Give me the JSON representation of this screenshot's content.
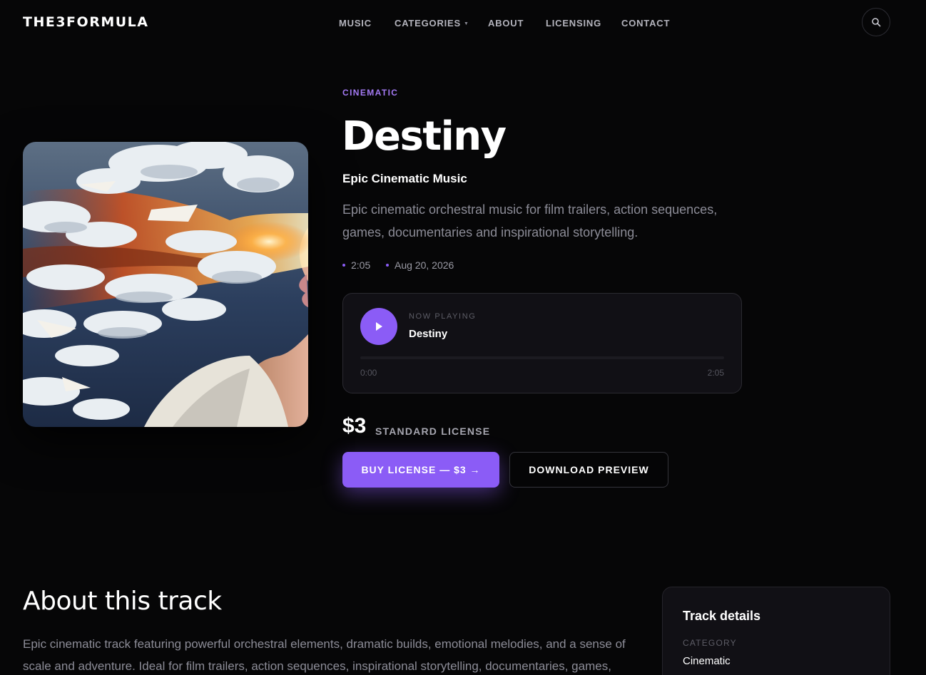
{
  "brand": {
    "logo": "THE3FORMULA",
    "accent_color": "#8b5cf6"
  },
  "nav": {
    "items": [
      {
        "label": "MUSIC"
      },
      {
        "label": "CATEGORIES",
        "has_dropdown": true
      },
      {
        "label": "ABOUT"
      },
      {
        "label": "LICENSING"
      },
      {
        "label": "CONTACT"
      }
    ],
    "search_icon": "search-icon"
  },
  "track": {
    "genre": "CINEMATIC",
    "title": "Destiny",
    "subtitle": "Epic Cinematic Music",
    "description": "Epic cinematic orchestral music for film trailers, action sequences, games, documentaries and inspirational storytelling.",
    "duration": "2:05",
    "date": "Aug 20, 2026",
    "cover_art": "surreal painting of a person's profile dissolving into clouds with fiery light"
  },
  "player": {
    "label": "NOW PLAYING",
    "title": "Destiny",
    "current_time": "0:00",
    "total_time": "2:05",
    "progress": 0,
    "play_icon": "play-icon"
  },
  "pricing": {
    "price": "$3",
    "license": "STANDARD LICENSE",
    "buy_label": "BUY LICENSE — $3 →",
    "preview_label": "DOWNLOAD PREVIEW"
  },
  "about": {
    "heading": "About this track",
    "text": "Epic cinematic track featuring powerful orchestral elements, dramatic builds, emotional melodies, and a sense of scale and adventure. Ideal for film trailers, action sequences, inspirational storytelling, documentaries, games, and"
  },
  "details": {
    "heading": "Track details",
    "category_label": "CATEGORY",
    "category_value": "Cinematic"
  }
}
